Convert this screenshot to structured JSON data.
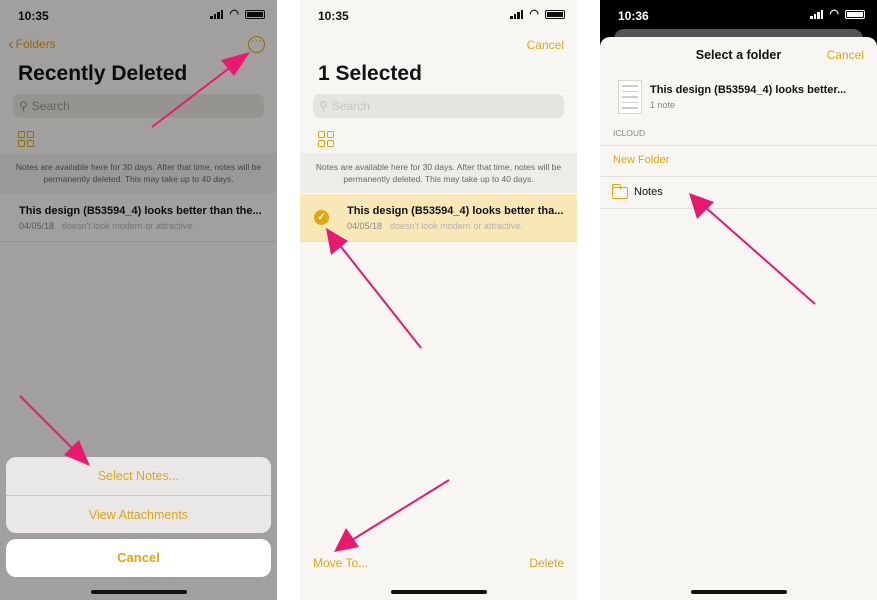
{
  "colors": {
    "accent": "#e2a612",
    "arrow": "#e8196e"
  },
  "screen1": {
    "time": "10:35",
    "back_label": "Folders",
    "more_icon": "ellipsis-circle-icon",
    "title": "Recently Deleted",
    "search_placeholder": "Search",
    "info_text": "Notes are available here for 30 days. After that time, notes will be permanently deleted. This may take up to 40 days.",
    "note": {
      "title": "This design (B53594_4) looks better than the...",
      "date": "04/05/18",
      "preview": "doesn't look modern or attractive."
    },
    "actions": [
      {
        "label": "Select Notes..."
      },
      {
        "label": "View Attachments"
      }
    ],
    "cancel_label": "Cancel"
  },
  "screen2": {
    "time": "10:35",
    "cancel_label": "Cancel",
    "title": "1 Selected",
    "search_placeholder": "Search",
    "info_text": "Notes are available here for 30 days. After that time, notes will be permanently deleted. This may take up to 40 days.",
    "note": {
      "title": "This design (B53594_4) looks better tha...",
      "date": "04/05/18",
      "preview": "doesn't look modern or attractive."
    },
    "move_label": "Move To...",
    "delete_label": "Delete"
  },
  "screen3": {
    "time": "10:36",
    "title": "Select a folder",
    "cancel_label": "Cancel",
    "note_title": "This design (B53594_4) looks better...",
    "note_count": "1 note",
    "section": "ICLOUD",
    "new_folder_label": "New Folder",
    "folder_label": "Notes"
  }
}
